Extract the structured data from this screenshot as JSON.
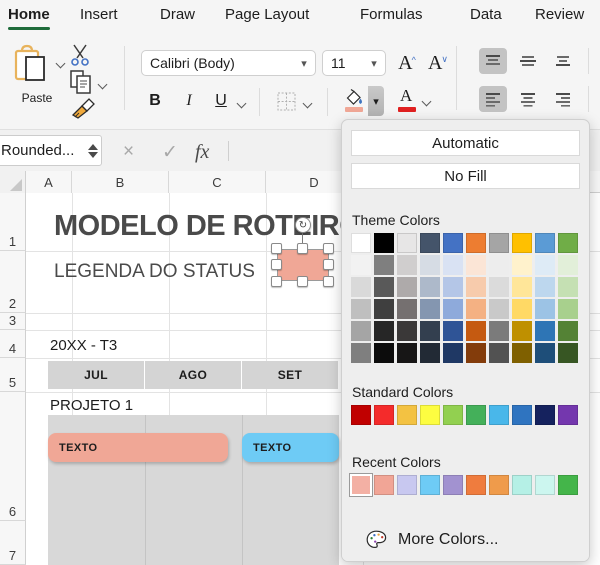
{
  "window": {
    "app": "Excel"
  },
  "tabs": [
    {
      "label": "Home",
      "active": true
    },
    {
      "label": "Insert",
      "active": false
    },
    {
      "label": "Draw",
      "active": false
    },
    {
      "label": "Page Layout",
      "active": false
    },
    {
      "label": "Formulas",
      "active": false
    },
    {
      "label": "Data",
      "active": false
    },
    {
      "label": "Review",
      "active": false
    }
  ],
  "ribbon": {
    "paste_label": "Paste",
    "font_name": "Calibri (Body)",
    "font_size": "11",
    "bold_label": "B",
    "italic_label": "I",
    "underline_label": "U",
    "grow_font_label": "A",
    "shrink_font_label": "A",
    "fill_swatch": "#f0a796",
    "font_color_swatch": "#e02020"
  },
  "formula_bar": {
    "name_box_value": "Rounded...",
    "cancel_label": "×",
    "enter_label": "✓",
    "fx_label": "fx",
    "formula_value": ""
  },
  "grid": {
    "columns": [
      "A",
      "B",
      "C",
      "D"
    ],
    "rows": [
      "1",
      "2",
      "3",
      "4",
      "5",
      "6",
      "7"
    ],
    "title": "MODELO DE ROTEIRO",
    "legend": "LEGENDA DO STATUS",
    "quarter": "20XX - T3",
    "months": [
      "JUL",
      "AGO",
      "SET"
    ],
    "project": "PROJETO 1",
    "bars": [
      {
        "label": "TEXTO",
        "color": "#f0a796"
      },
      {
        "label": "TEXTO",
        "color": "#6ecbf5"
      }
    ],
    "selected_shape_color": "#f0a796",
    "rotate_handle_label": "↻"
  },
  "fill_picker": {
    "automatic_label": "Automatic",
    "no_fill_label": "No Fill",
    "theme_title": "Theme Colors",
    "standard_title": "Standard Colors",
    "recent_title": "Recent Colors",
    "more_colors_label": "More Colors...",
    "theme_base": [
      "#ffffff",
      "#000000",
      "#e7e6e6",
      "#44546a",
      "#4472c4",
      "#ed7d31",
      "#a5a5a5",
      "#ffc000",
      "#5b9bd5",
      "#70ad47"
    ],
    "theme_variants": [
      [
        "#f2f2f2",
        "#7f7f7f",
        "#d0cece",
        "#d6dce4",
        "#d9e2f3",
        "#fbe5d6",
        "#ededed",
        "#fff2cc",
        "#deebf6",
        "#e2efd9"
      ],
      [
        "#d9d9d9",
        "#595959",
        "#aeaaaa",
        "#adb9ca",
        "#b4c6e7",
        "#f7cbac",
        "#dbdbdb",
        "#ffe699",
        "#bdd7ee",
        "#c5e0b3"
      ],
      [
        "#bfbfbf",
        "#3f3f3f",
        "#757070",
        "#8496b0",
        "#8eaadb",
        "#f4b183",
        "#c9c9c9",
        "#ffd965",
        "#9cc3e5",
        "#a8d08d"
      ],
      [
        "#a5a5a5",
        "#262626",
        "#3a3838",
        "#333f4f",
        "#2f5496",
        "#c55a11",
        "#7b7b7b",
        "#bf9000",
        "#2e75b5",
        "#548235"
      ],
      [
        "#7f7f7f",
        "#0c0c0c",
        "#171616",
        "#222a35",
        "#1f3864",
        "#833c0b",
        "#525252",
        "#7f6000",
        "#1e4e79",
        "#375623"
      ]
    ],
    "standard": [
      "#c00000",
      "#f42b2b",
      "#f3c242",
      "#fdfd41",
      "#92d050",
      "#44b05a",
      "#49b7ea",
      "#2f74c0",
      "#15225e",
      "#7437ae"
    ],
    "recent": [
      "#f3b0a4",
      "#f1a596",
      "#c8c8f0",
      "#6ecbf5",
      "#a292d0",
      "#ef7c3e",
      "#ef9b4b",
      "#b5f0e6",
      "#ccf6ef",
      "#44b54a"
    ],
    "recent_selected_index": 0,
    "palette_icon": "palette-icon"
  }
}
